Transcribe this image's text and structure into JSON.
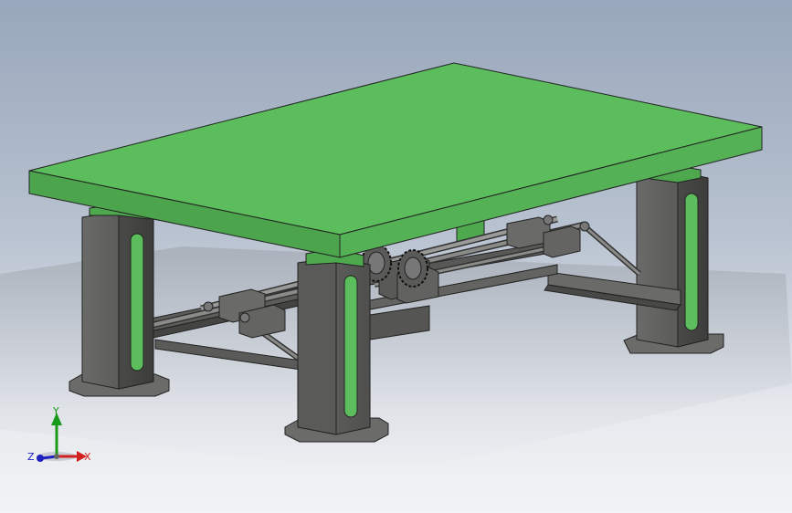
{
  "model": {
    "tabletop_color": "#5bbd5b",
    "leg_color": "#5a5a58",
    "slot_color": "#5bbd5b",
    "frame_color": "#646462"
  },
  "triad": {
    "y_label": "Y",
    "x_label": "X",
    "z_label": "Z",
    "y_color": "#1a9a1a",
    "x_color": "#d02020",
    "z_color": "#2020c0"
  }
}
